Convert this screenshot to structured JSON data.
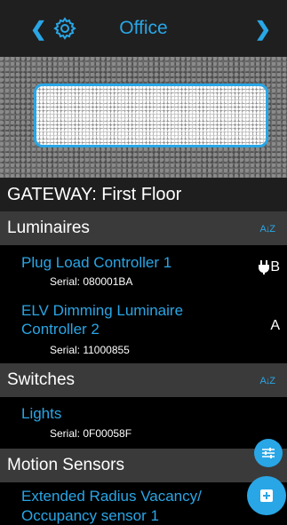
{
  "header": {
    "title": "Office",
    "back_icon": "chevron-left-icon",
    "settings_icon": "gear-icon",
    "next_icon": "chevron-right-icon"
  },
  "gateway": {
    "label": "GATEWAY: First Floor"
  },
  "sections": {
    "luminaires": {
      "label": "Luminaires",
      "sort_icon": "sort-az-icon",
      "items": [
        {
          "name": "Plug Load Controller 1",
          "serial": "Serial:  080001BA",
          "badge": "B",
          "badge_icon": "plug-icon"
        },
        {
          "name_line1": "ELV Dimming Luminaire",
          "name_line2": "Controller 2",
          "serial": "Serial:  11000855",
          "badge": "A"
        }
      ]
    },
    "switches": {
      "label": "Switches",
      "sort_icon": "sort-az-icon",
      "items": [
        {
          "name": "Lights",
          "serial": "Serial:  0F00058F"
        }
      ]
    },
    "motion": {
      "label": "Motion Sensors",
      "items": [
        {
          "name_line1": "Extended Radius Vacancy/",
          "name_line2": "Occupancy sensor 1"
        }
      ]
    }
  },
  "colors": {
    "accent": "#29a6e6",
    "section_bg": "#3a3a3a",
    "header_bg": "#1f1f1f"
  }
}
